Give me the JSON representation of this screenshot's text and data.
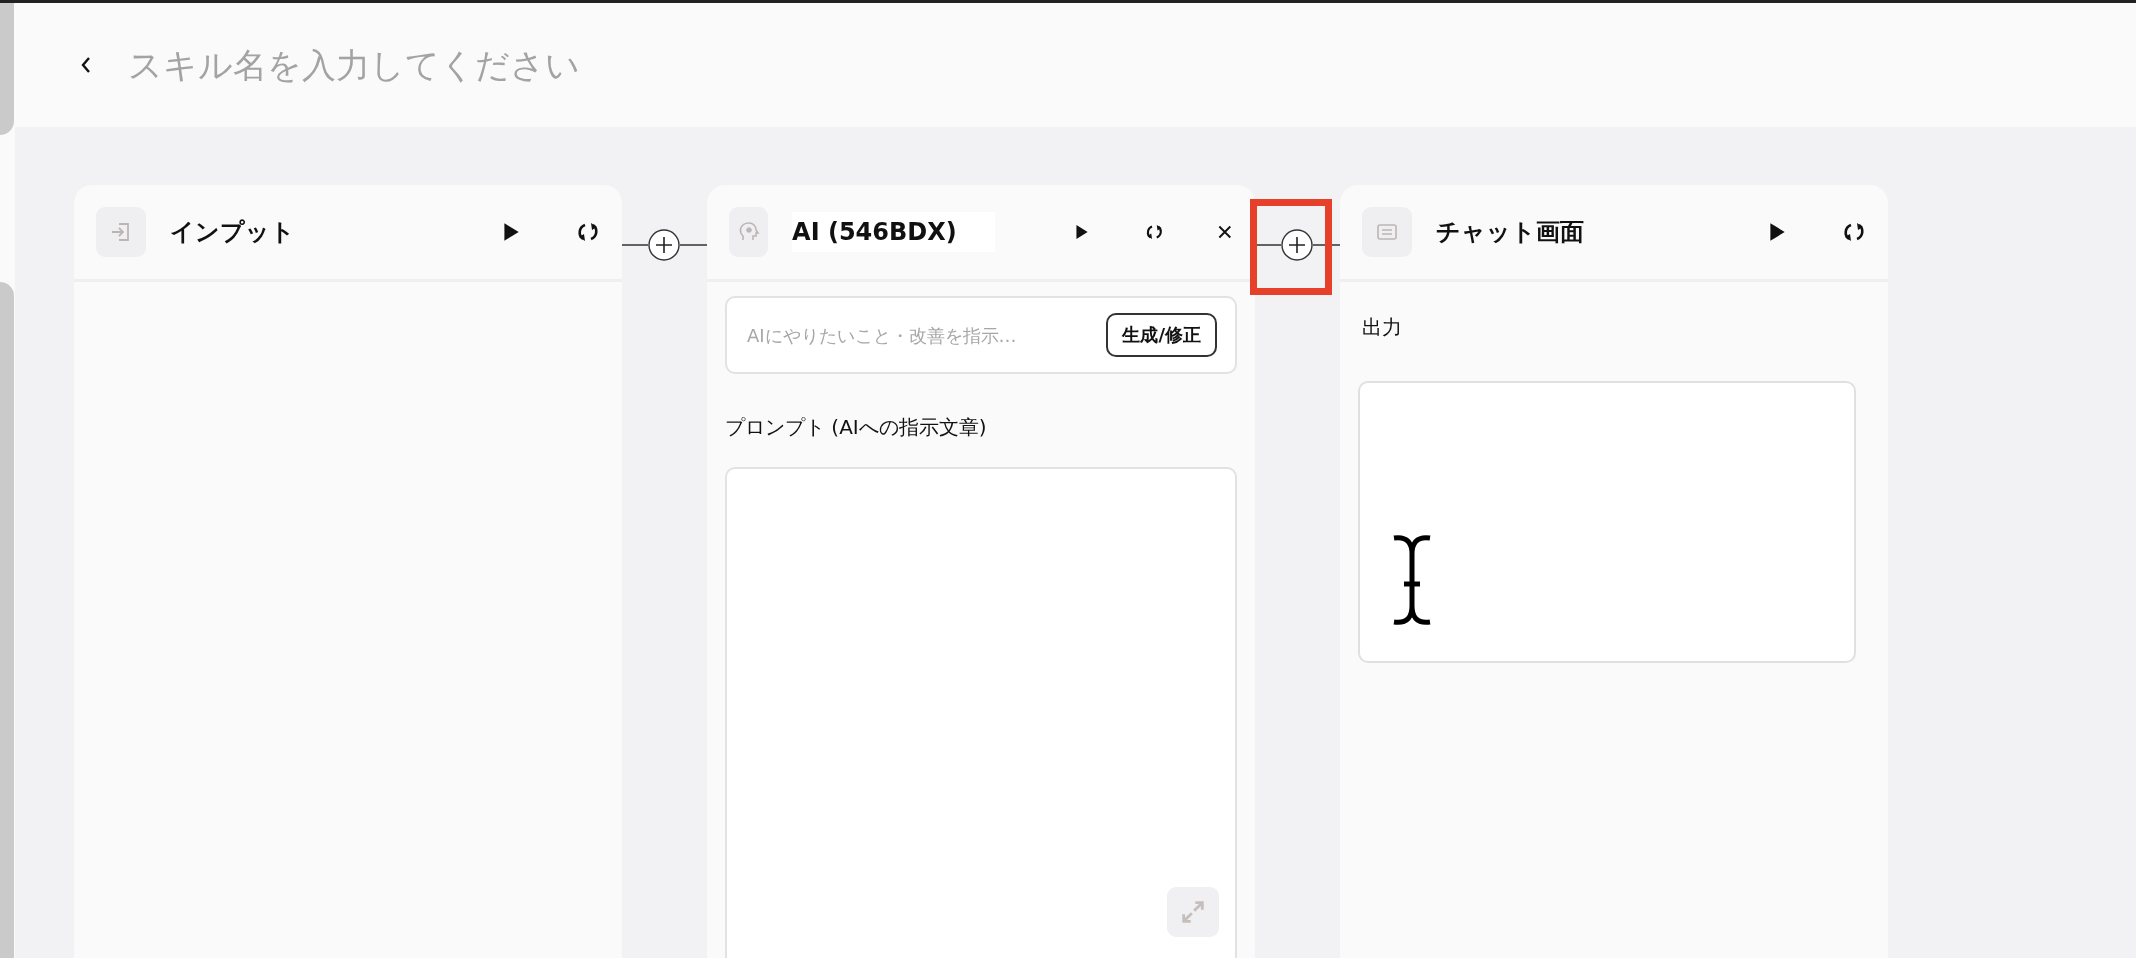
{
  "header": {
    "title_placeholder": "スキル名を入力してください"
  },
  "nodes": [
    {
      "kind": "input",
      "title": "インプット",
      "closable": false
    },
    {
      "kind": "ai",
      "title": "AI (546BDX)",
      "closable": true,
      "instruction_placeholder": "AIにやりたいこと・改善を指示…",
      "generate_button": "生成/修正",
      "prompt_label": "プロンプト (AIへの指示文章)"
    },
    {
      "kind": "chat",
      "title": "チャット画面",
      "closable": false,
      "output_label": "出力"
    }
  ],
  "connectors": [
    {
      "highlighted": false
    },
    {
      "highlighted": true
    }
  ]
}
